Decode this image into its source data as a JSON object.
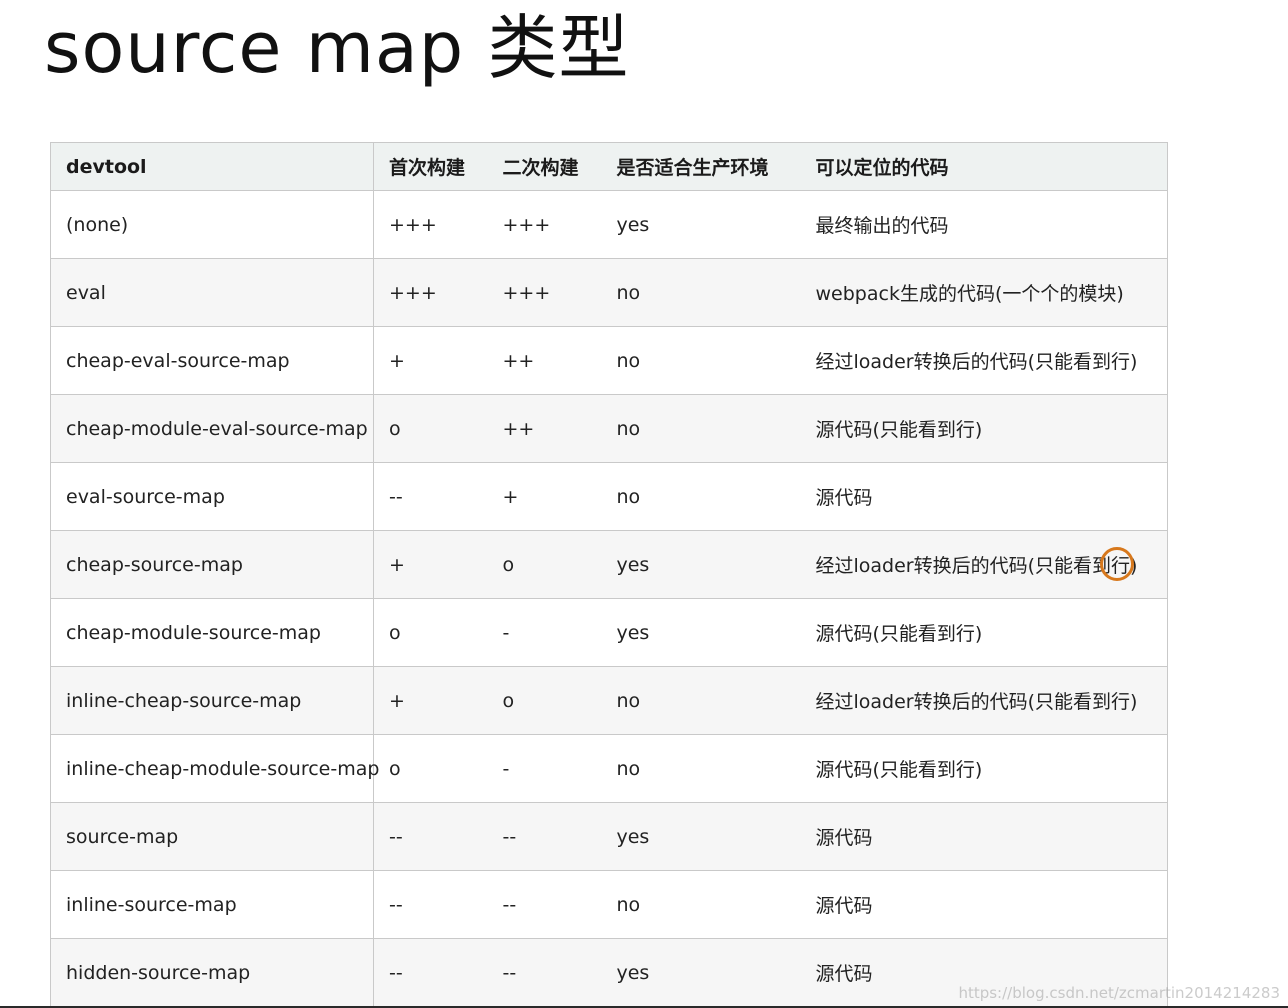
{
  "title": "source map 类型",
  "table": {
    "headers": [
      "devtool",
      "首次构建",
      "二次构建",
      "是否适合生产环境",
      "可以定位的代码"
    ],
    "rows": [
      [
        "(none)",
        "+++",
        "+++",
        "yes",
        "最终输出的代码"
      ],
      [
        "eval",
        "+++",
        "+++",
        "no",
        "webpack生成的代码(一个个的模块)"
      ],
      [
        "cheap-eval-source-map",
        "+",
        "++",
        "no",
        "经过loader转换后的代码(只能看到行)"
      ],
      [
        "cheap-module-eval-source-map",
        "o",
        "++",
        "no",
        "源代码(只能看到行)"
      ],
      [
        "eval-source-map",
        "--",
        "+",
        "no",
        "源代码"
      ],
      [
        "cheap-source-map",
        "+",
        "o",
        "yes",
        "经过loader转换后的代码(只能看到行)"
      ],
      [
        "cheap-module-source-map",
        "o",
        "-",
        "yes",
        "源代码(只能看到行)"
      ],
      [
        "inline-cheap-source-map",
        "+",
        "o",
        "no",
        "经过loader转换后的代码(只能看到行)"
      ],
      [
        "inline-cheap-module-source-map",
        "o",
        "-",
        "no",
        "源代码(只能看到行)"
      ],
      [
        "source-map",
        "--",
        "--",
        "yes",
        "源代码"
      ],
      [
        "inline-source-map",
        "--",
        "--",
        "no",
        "源代码"
      ],
      [
        "hidden-source-map",
        "--",
        "--",
        "yes",
        "源代码"
      ]
    ]
  },
  "watermark": "https://blog.csdn.net/zcmartin2014214283",
  "cursor_ring_color": "#d7781c"
}
